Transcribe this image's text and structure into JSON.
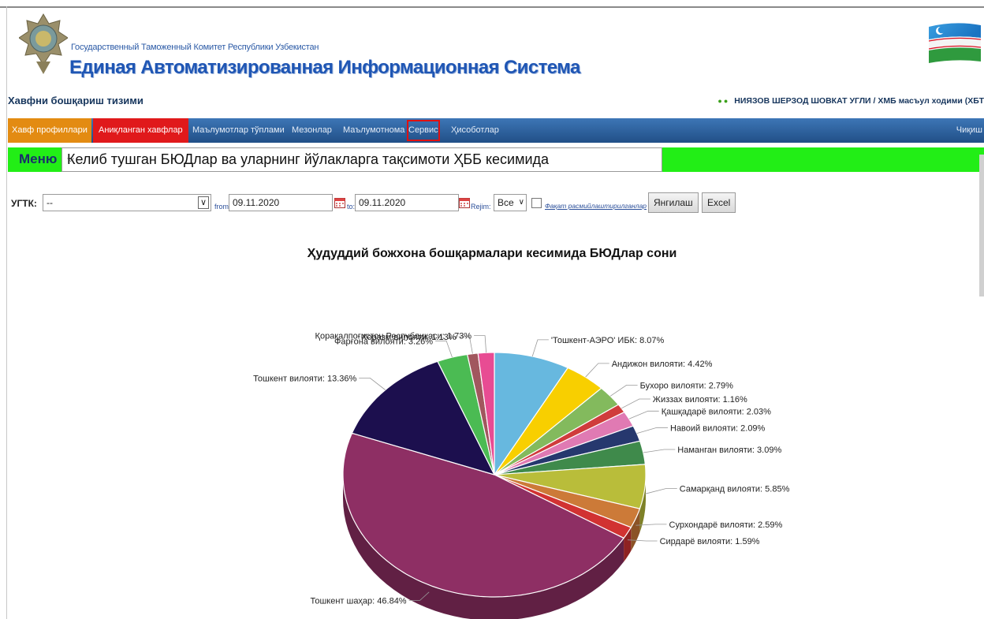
{
  "header": {
    "subtitle": "Государственный Таможенный Комитет Республики Узбекистан",
    "title": "Единая Автоматизированная Информационная Система"
  },
  "subbar": {
    "system_title": "Хавфни бошқариш тизими",
    "user": "НИЯЗОВ ШЕРЗОД ШОВКАТ УГЛИ / ХМБ масъул ходими (ХБТ"
  },
  "nav": {
    "items": [
      "Хавф профиллари",
      "Аниқланган хавфлар",
      "Маълумотлар тўплами",
      "Мезонлар",
      "Маълумотнома",
      "Сервис",
      "Ҳисоботлар"
    ],
    "logout": "Чиқиш"
  },
  "menu": {
    "label": "Меню",
    "selected": "Келиб тушган БЮДлар ва уларнинг йўлакларга тақсимоти ҲББ кесимида"
  },
  "filters": {
    "ugtk_label": "УГТК:",
    "ugtk_value": "--",
    "from_label": "from:",
    "from_value": "09.11.2020",
    "to_label": "to:",
    "to_value": "09.11.2020",
    "rejim_label": "Rejim:",
    "rejim_value": "Все",
    "only_label": "Фақат расмийлаштирилганлар",
    "refresh_button": "Янгилаш",
    "excel_button": "Excel"
  },
  "chart_data": {
    "type": "pie",
    "title": "Ҳудуддий божхона бошқармалари кесимида БЮДлар сони",
    "slices": [
      {
        "label": "'Тошкент-АЭРО' ИБК: 8.07%",
        "value": 8.07,
        "color": "#67b8df"
      },
      {
        "label": "Андижон вилояти: 4.42%",
        "value": 4.42,
        "color": "#f8cf00"
      },
      {
        "label": "Бухоро вилояти: 2.79%",
        "value": 2.79,
        "color": "#83ba5d"
      },
      {
        "label": "Жиззах вилояти: 1.16%",
        "value": 1.16,
        "color": "#d03c3c"
      },
      {
        "label": "Қашқадарё вилояти: 2.03%",
        "value": 2.03,
        "color": "#e07ab3"
      },
      {
        "label": "Навоий вилояти: 2.09%",
        "value": 2.09,
        "color": "#26386e"
      },
      {
        "label": "Наманган вилояти: 3.09%",
        "value": 3.09,
        "color": "#3f8a4b"
      },
      {
        "label": "Самарқанд вилояти: 5.85%",
        "value": 5.85,
        "color": "#b9bd3a"
      },
      {
        "label": "Сурхондарё вилояти: 2.59%",
        "value": 2.59,
        "color": "#cc7a38"
      },
      {
        "label": "Сирдарё вилояти: 1.59%",
        "value": 1.59,
        "color": "#d13232"
      },
      {
        "label": "Тошкент шаҳар: 46.84%",
        "value": 46.84,
        "color": "#8e2f64"
      },
      {
        "label": "Тошкент вилояти: 13.36%",
        "value": 13.36,
        "color": "#1c0f4e"
      },
      {
        "label": "Фарғона вилояти: 3.26%",
        "value": 3.26,
        "color": "#4bbb53"
      },
      {
        "label": "Хоразм вилояти: 1.13%",
        "value": 1.13,
        "color": "#a1575e"
      },
      {
        "label": "Қорақалпоғистон Республикаси: 1.73%",
        "value": 1.73,
        "color": "#e84c93"
      }
    ],
    "style": "3d",
    "legend": "none"
  }
}
